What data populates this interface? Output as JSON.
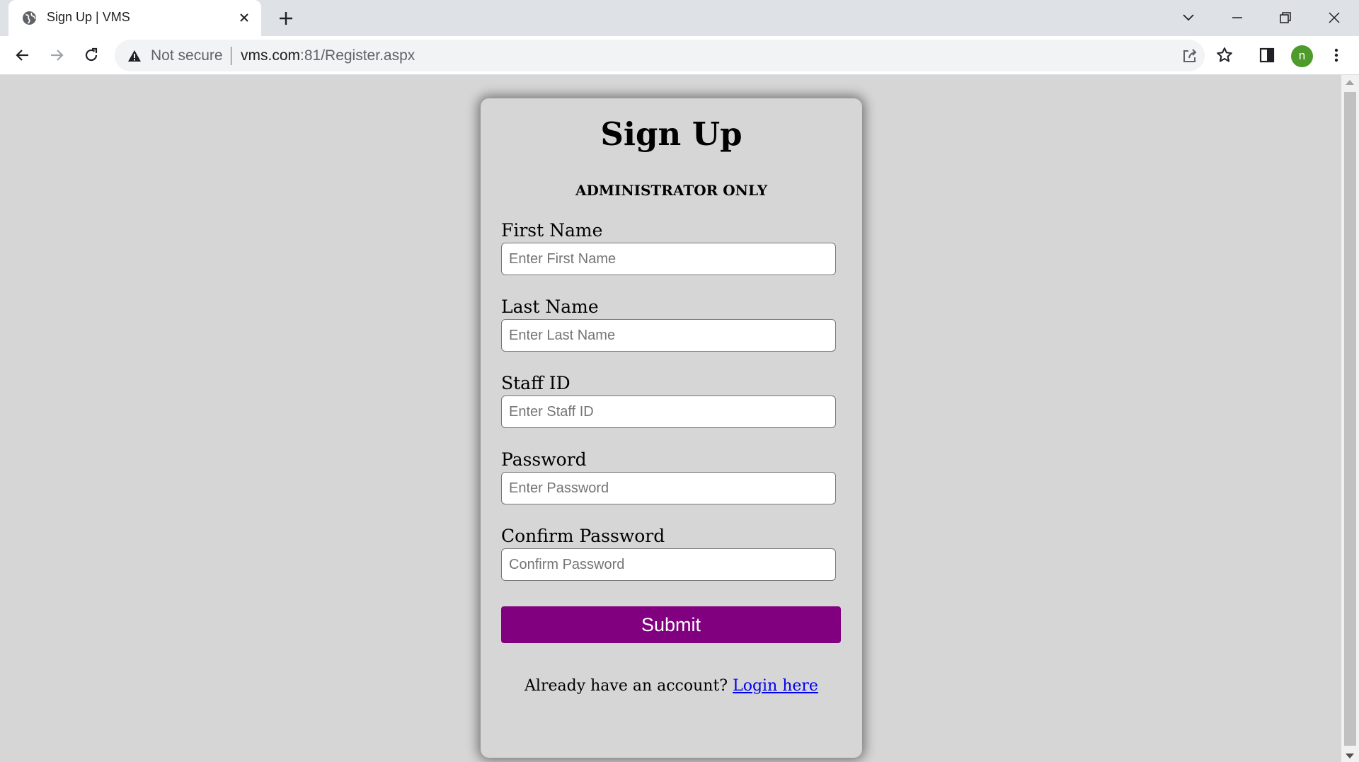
{
  "browser": {
    "tab_title": "Sign Up | VMS",
    "security_label": "Not secure",
    "url_host": "vms.com",
    "url_rest": ":81/Register.aspx",
    "profile_initial": "n",
    "profile_color": "#4e9a2a"
  },
  "page": {
    "title": "Sign Up",
    "subtitle": "ADMINISTRATOR ONLY",
    "fields": [
      {
        "label": "First Name",
        "placeholder": "Enter First Name",
        "value": ""
      },
      {
        "label": "Last Name",
        "placeholder": "Enter Last Name",
        "value": ""
      },
      {
        "label": "Staff ID",
        "placeholder": "Enter Staff ID",
        "value": ""
      },
      {
        "label": "Password",
        "placeholder": "Enter Password",
        "value": ""
      },
      {
        "label": "Confirm Password",
        "placeholder": "Confirm Password",
        "value": ""
      }
    ],
    "submit_label": "Submit",
    "submit_color": "#800080",
    "login_prompt": "Already have an account? ",
    "login_link": "Login here"
  }
}
